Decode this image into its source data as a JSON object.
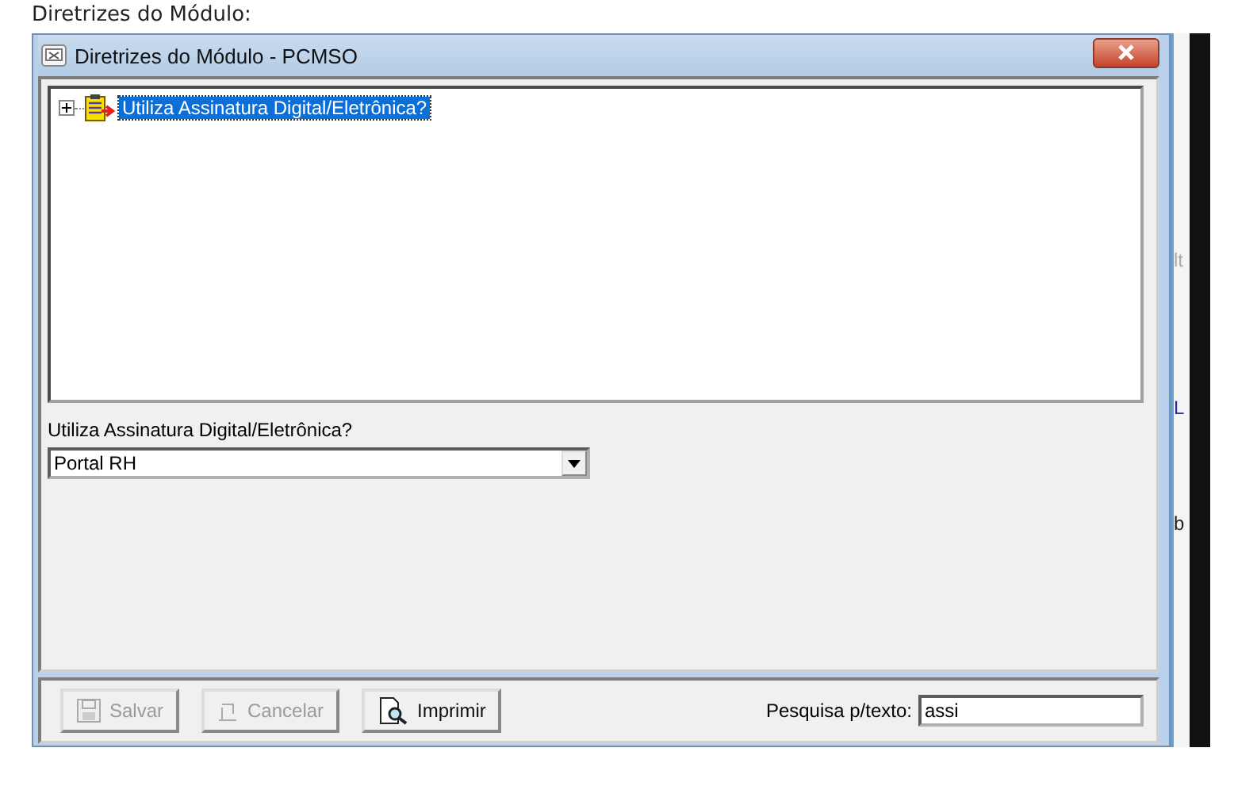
{
  "caption": "Diretrizes do Módulo:",
  "window": {
    "title": "Diretrizes do Módulo - PCMSO"
  },
  "tree": {
    "items": [
      {
        "label": "Utiliza Assinatura Digital/Eletrônica?",
        "expanded": false,
        "selected": true
      }
    ]
  },
  "field": {
    "label": "Utiliza Assinatura Digital/Eletrônica?",
    "value": "Portal RH"
  },
  "buttons": [
    {
      "label": "Salvar",
      "kind": "save",
      "disabled": true
    },
    {
      "label": "Cancelar",
      "kind": "cancel",
      "disabled": true
    },
    {
      "label": "Imprimir",
      "kind": "print",
      "disabled": false
    }
  ],
  "search": {
    "label": "Pesquisa p/texto:",
    "value": "assi"
  },
  "background_fragments": [
    {
      "text": "lt",
      "kind": "grey"
    },
    {
      "text": "L",
      "kind": "link"
    },
    {
      "text": "b",
      "kind": "plain"
    }
  ]
}
